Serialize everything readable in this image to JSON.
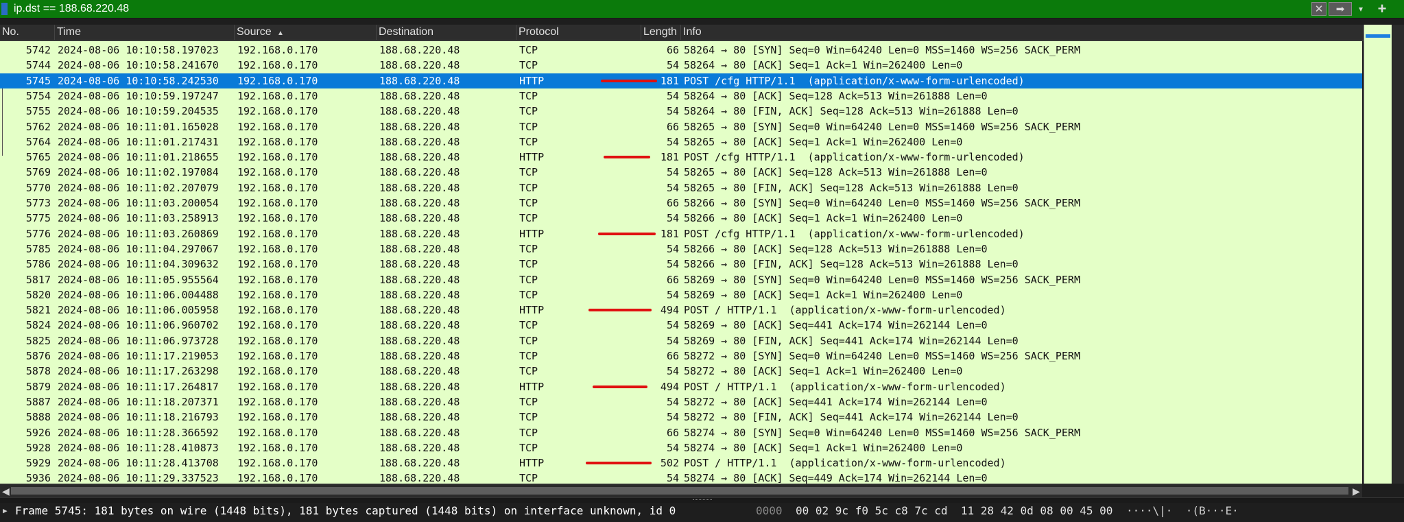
{
  "filter": {
    "text": "ip.dst == 188.68.220.48",
    "clear_icon": "✕",
    "apply_icon": "➡",
    "dropdown_icon": "▾",
    "add_icon": "+"
  },
  "columns": [
    "No.",
    "Time",
    "Source",
    "Destination",
    "Protocol",
    "Length",
    "Info"
  ],
  "packets": [
    {
      "no": "5742",
      "time": "2024-08-06 10:10:58.197023",
      "src": "192.168.0.170",
      "dst": "188.68.220.48",
      "proto": "TCP",
      "len": "66",
      "info": "58264 → 80 [SYN] Seq=0 Win=64240 Len=0 MSS=1460 WS=256 SACK_PERM"
    },
    {
      "no": "5744",
      "time": "2024-08-06 10:10:58.241670",
      "src": "192.168.0.170",
      "dst": "188.68.220.48",
      "proto": "TCP",
      "len": "54",
      "info": "58264 → 80 [ACK] Seq=1 Ack=1 Win=262400 Len=0"
    },
    {
      "no": "5745",
      "time": "2024-08-06 10:10:58.242530",
      "src": "192.168.0.170",
      "dst": "188.68.220.48",
      "proto": "HTTP",
      "len": "181",
      "info": "POST /cfg HTTP/1.1  (application/x-www-form-urlencoded)",
      "selected": true
    },
    {
      "no": "5754",
      "time": "2024-08-06 10:10:59.197247",
      "src": "192.168.0.170",
      "dst": "188.68.220.48",
      "proto": "TCP",
      "len": "54",
      "info": "58264 → 80 [ACK] Seq=128 Ack=513 Win=261888 Len=0"
    },
    {
      "no": "5755",
      "time": "2024-08-06 10:10:59.204535",
      "src": "192.168.0.170",
      "dst": "188.68.220.48",
      "proto": "TCP",
      "len": "54",
      "info": "58264 → 80 [FIN, ACK] Seq=128 Ack=513 Win=261888 Len=0"
    },
    {
      "no": "5762",
      "time": "2024-08-06 10:11:01.165028",
      "src": "192.168.0.170",
      "dst": "188.68.220.48",
      "proto": "TCP",
      "len": "66",
      "info": "58265 → 80 [SYN] Seq=0 Win=64240 Len=0 MSS=1460 WS=256 SACK_PERM"
    },
    {
      "no": "5764",
      "time": "2024-08-06 10:11:01.217431",
      "src": "192.168.0.170",
      "dst": "188.68.220.48",
      "proto": "TCP",
      "len": "54",
      "info": "58265 → 80 [ACK] Seq=1 Ack=1 Win=262400 Len=0"
    },
    {
      "no": "5765",
      "time": "2024-08-06 10:11:01.218655",
      "src": "192.168.0.170",
      "dst": "188.68.220.48",
      "proto": "HTTP",
      "len": "181",
      "info": "POST /cfg HTTP/1.1  (application/x-www-form-urlencoded)"
    },
    {
      "no": "5769",
      "time": "2024-08-06 10:11:02.197084",
      "src": "192.168.0.170",
      "dst": "188.68.220.48",
      "proto": "TCP",
      "len": "54",
      "info": "58265 → 80 [ACK] Seq=128 Ack=513 Win=261888 Len=0"
    },
    {
      "no": "5770",
      "time": "2024-08-06 10:11:02.207079",
      "src": "192.168.0.170",
      "dst": "188.68.220.48",
      "proto": "TCP",
      "len": "54",
      "info": "58265 → 80 [FIN, ACK] Seq=128 Ack=513 Win=261888 Len=0"
    },
    {
      "no": "5773",
      "time": "2024-08-06 10:11:03.200054",
      "src": "192.168.0.170",
      "dst": "188.68.220.48",
      "proto": "TCP",
      "len": "66",
      "info": "58266 → 80 [SYN] Seq=0 Win=64240 Len=0 MSS=1460 WS=256 SACK_PERM"
    },
    {
      "no": "5775",
      "time": "2024-08-06 10:11:03.258913",
      "src": "192.168.0.170",
      "dst": "188.68.220.48",
      "proto": "TCP",
      "len": "54",
      "info": "58266 → 80 [ACK] Seq=1 Ack=1 Win=262400 Len=0"
    },
    {
      "no": "5776",
      "time": "2024-08-06 10:11:03.260869",
      "src": "192.168.0.170",
      "dst": "188.68.220.48",
      "proto": "HTTP",
      "len": "181",
      "info": "POST /cfg HTTP/1.1  (application/x-www-form-urlencoded)"
    },
    {
      "no": "5785",
      "time": "2024-08-06 10:11:04.297067",
      "src": "192.168.0.170",
      "dst": "188.68.220.48",
      "proto": "TCP",
      "len": "54",
      "info": "58266 → 80 [ACK] Seq=128 Ack=513 Win=261888 Len=0"
    },
    {
      "no": "5786",
      "time": "2024-08-06 10:11:04.309632",
      "src": "192.168.0.170",
      "dst": "188.68.220.48",
      "proto": "TCP",
      "len": "54",
      "info": "58266 → 80 [FIN, ACK] Seq=128 Ack=513 Win=261888 Len=0"
    },
    {
      "no": "5817",
      "time": "2024-08-06 10:11:05.955564",
      "src": "192.168.0.170",
      "dst": "188.68.220.48",
      "proto": "TCP",
      "len": "66",
      "info": "58269 → 80 [SYN] Seq=0 Win=64240 Len=0 MSS=1460 WS=256 SACK_PERM"
    },
    {
      "no": "5820",
      "time": "2024-08-06 10:11:06.004488",
      "src": "192.168.0.170",
      "dst": "188.68.220.48",
      "proto": "TCP",
      "len": "54",
      "info": "58269 → 80 [ACK] Seq=1 Ack=1 Win=262400 Len=0"
    },
    {
      "no": "5821",
      "time": "2024-08-06 10:11:06.005958",
      "src": "192.168.0.170",
      "dst": "188.68.220.48",
      "proto": "HTTP",
      "len": "494",
      "info": "POST / HTTP/1.1  (application/x-www-form-urlencoded)"
    },
    {
      "no": "5824",
      "time": "2024-08-06 10:11:06.960702",
      "src": "192.168.0.170",
      "dst": "188.68.220.48",
      "proto": "TCP",
      "len": "54",
      "info": "58269 → 80 [ACK] Seq=441 Ack=174 Win=262144 Len=0"
    },
    {
      "no": "5825",
      "time": "2024-08-06 10:11:06.973728",
      "src": "192.168.0.170",
      "dst": "188.68.220.48",
      "proto": "TCP",
      "len": "54",
      "info": "58269 → 80 [FIN, ACK] Seq=441 Ack=174 Win=262144 Len=0"
    },
    {
      "no": "5876",
      "time": "2024-08-06 10:11:17.219053",
      "src": "192.168.0.170",
      "dst": "188.68.220.48",
      "proto": "TCP",
      "len": "66",
      "info": "58272 → 80 [SYN] Seq=0 Win=64240 Len=0 MSS=1460 WS=256 SACK_PERM"
    },
    {
      "no": "5878",
      "time": "2024-08-06 10:11:17.263298",
      "src": "192.168.0.170",
      "dst": "188.68.220.48",
      "proto": "TCP",
      "len": "54",
      "info": "58272 → 80 [ACK] Seq=1 Ack=1 Win=262400 Len=0"
    },
    {
      "no": "5879",
      "time": "2024-08-06 10:11:17.264817",
      "src": "192.168.0.170",
      "dst": "188.68.220.48",
      "proto": "HTTP",
      "len": "494",
      "info": "POST / HTTP/1.1  (application/x-www-form-urlencoded)"
    },
    {
      "no": "5887",
      "time": "2024-08-06 10:11:18.207371",
      "src": "192.168.0.170",
      "dst": "188.68.220.48",
      "proto": "TCP",
      "len": "54",
      "info": "58272 → 80 [ACK] Seq=441 Ack=174 Win=262144 Len=0"
    },
    {
      "no": "5888",
      "time": "2024-08-06 10:11:18.216793",
      "src": "192.168.0.170",
      "dst": "188.68.220.48",
      "proto": "TCP",
      "len": "54",
      "info": "58272 → 80 [FIN, ACK] Seq=441 Ack=174 Win=262144 Len=0"
    },
    {
      "no": "5926",
      "time": "2024-08-06 10:11:28.366592",
      "src": "192.168.0.170",
      "dst": "188.68.220.48",
      "proto": "TCP",
      "len": "66",
      "info": "58274 → 80 [SYN] Seq=0 Win=64240 Len=0 MSS=1460 WS=256 SACK_PERM"
    },
    {
      "no": "5928",
      "time": "2024-08-06 10:11:28.410873",
      "src": "192.168.0.170",
      "dst": "188.68.220.48",
      "proto": "TCP",
      "len": "54",
      "info": "58274 → 80 [ACK] Seq=1 Ack=1 Win=262400 Len=0"
    },
    {
      "no": "5929",
      "time": "2024-08-06 10:11:28.413708",
      "src": "192.168.0.170",
      "dst": "188.68.220.48",
      "proto": "HTTP",
      "len": "502",
      "info": "POST / HTTP/1.1  (application/x-www-form-urlencoded)"
    },
    {
      "no": "5936",
      "time": "2024-08-06 10:11:29.337523",
      "src": "192.168.0.170",
      "dst": "188.68.220.48",
      "proto": "TCP",
      "len": "54",
      "info": "58274 → 80 [ACK] Seq=449 Ack=174 Win=262144 Len=0"
    }
  ],
  "detail": {
    "line1": "Frame 5745: 181 bytes on wire (1448 bits), 181 bytes captured (1448 bits) on interface unknown, id 0"
  },
  "hex": {
    "offset": "0000",
    "bytes": "00 02 9c f0 5c c8 7c cd  11 28 42 0d 08 00 45 00",
    "ascii": "····\\|·  ·(B···E·"
  },
  "colors": {
    "row_bg": "#e4ffc7",
    "selected_bg": "#0a7ad8",
    "filter_bg": "#0b7a0b",
    "annotation": "#e01010"
  }
}
